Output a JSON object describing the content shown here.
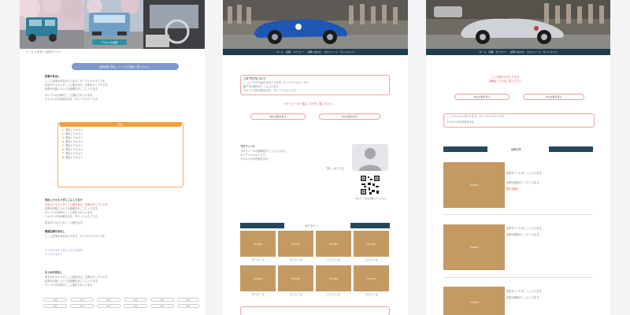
{
  "colors": {
    "nav": "#1f3d4c",
    "accent_red": "#d9534f",
    "accent_orange": "#f2a13c",
    "accent_blue": "#7d97cf",
    "thumb": "#c49a62"
  },
  "panel1": {
    "hero_caption": "アクセスの結果",
    "breadcrumb": "ホーム > 記事 > 記事タイトル",
    "notice_pill": "最新記事一覧は、ページの下部をご覧ください。",
    "section_title": "記事の見出し",
    "body_lines": [
      "ここに記事の本文が入ります。サンプルテキストです。",
      "本文のテキストがここに続きます。文章のサンプルです。",
      "記事の内容についての説明文がここに入ります。",
      "サンプルの文章がここに表示されています。",
      "テキストの行が続きます。ダミーテキストです。"
    ],
    "toc_title": "目次",
    "toc_items": [
      "1. 見出しテキスト",
      "2. 見出しテキスト",
      "3. 見出しテキスト",
      "4. 見出しテキスト",
      "5. 見出しテキスト",
      "6. 見出しテキスト",
      "7. 見出しテキスト",
      "8. 見出しテキスト"
    ],
    "heading2": "見出しテキストがここに入ります",
    "body2_lines": [
      "本文のテキストがここに続きます。文章のサンプルです。",
      "記事の内容についての説明文がここに入ります。",
      "サンプルの文章がここに表示されています。",
      "テキストの行が続きます。ダミーテキストです。",
      "本文のテキストがここに続きます。"
    ],
    "heading3": "関連記事の見出し",
    "links": [
      "リンクテキストがここに入ります",
      "リンクテキスト"
    ],
    "heading4": "まとめの見出し",
    "tags": [
      "タグ",
      "タグ",
      "タグ",
      "タグ",
      "タグ",
      "タグ",
      "タグ",
      "タグ",
      "タグ",
      "タグ",
      "タグ",
      "タグ"
    ]
  },
  "panel2": {
    "nav_items": [
      "ホーム",
      "記事",
      "カテゴリー",
      "お問い合わせ",
      "プロフィール",
      "サイトマップ"
    ],
    "intro_title": "このブログについて",
    "intro_lines": [
      "ここにブログの紹介文が入ります。サンプルテキストです。",
      "紹介文の続きがここに入ります。",
      "テキストの行が続きます。ダミーテキストです。"
    ],
    "red_notice": "カテゴリーの一覧はこちらをご覧ください。",
    "pill_left": "前の記事を見る",
    "pill_right": "次の記事を見る",
    "profile_name": "プロフィール",
    "profile_lines": [
      "プロフィールの説明文がここに入ります。",
      "サンプルテキストです。",
      "テキストの行が続きます。"
    ],
    "profile_link": "詳しくはこちら",
    "qr_caption": "QRコードを読み取ってください",
    "category_label": "カテゴリー",
    "thumb_label": "Image",
    "thumb_captions": [
      "カテゴリー名",
      "カテゴリー名",
      "カテゴリー名",
      "カテゴリー名",
      "カテゴリー名",
      "カテゴリー名",
      "カテゴリー名",
      "カテゴリー名"
    ]
  },
  "panel3": {
    "nav_items": [
      "ホーム",
      "記事",
      "カテゴリー",
      "お問い合わせ",
      "プロフィール",
      "サイトマップ"
    ],
    "red_notice_1": "ここにお知らせが入ります。",
    "red_notice_2": "詳細はこちらをご覧ください。",
    "pill_left": "前の記事を見る",
    "pill_right": "次の記事を見る",
    "box_lines": [
      "ここにテキストが入ります。サンプルテキストです。",
      "テキストの行が続きます。"
    ],
    "recent_label": "最新記事",
    "thumb_label": "Image",
    "post_lines": [
      "記事タイトルがここに入ります。",
      "記事の抜粋がここに入ります。",
      "続きを読む"
    ]
  }
}
